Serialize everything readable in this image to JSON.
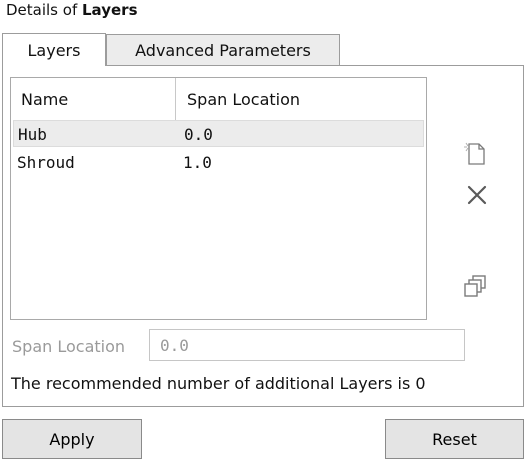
{
  "header": {
    "prefix": "Details of ",
    "bold": "Layers"
  },
  "tabs": [
    {
      "label": "Layers",
      "active": true
    },
    {
      "label": "Advanced Parameters",
      "active": false
    }
  ],
  "table": {
    "columns": [
      "Name",
      "Span Location"
    ],
    "rows": [
      {
        "name": "Hub",
        "span": "0.0",
        "selected": true
      },
      {
        "name": "Shroud",
        "span": "1.0",
        "selected": false
      }
    ]
  },
  "side_icons": [
    "new-document-icon",
    "delete-x-icon",
    "copy-icon"
  ],
  "span_field": {
    "label": "Span Location",
    "value": "0.0"
  },
  "recommendation": "The recommended number of additional Layers is 0",
  "buttons": {
    "apply": "Apply",
    "reset": "Reset"
  }
}
